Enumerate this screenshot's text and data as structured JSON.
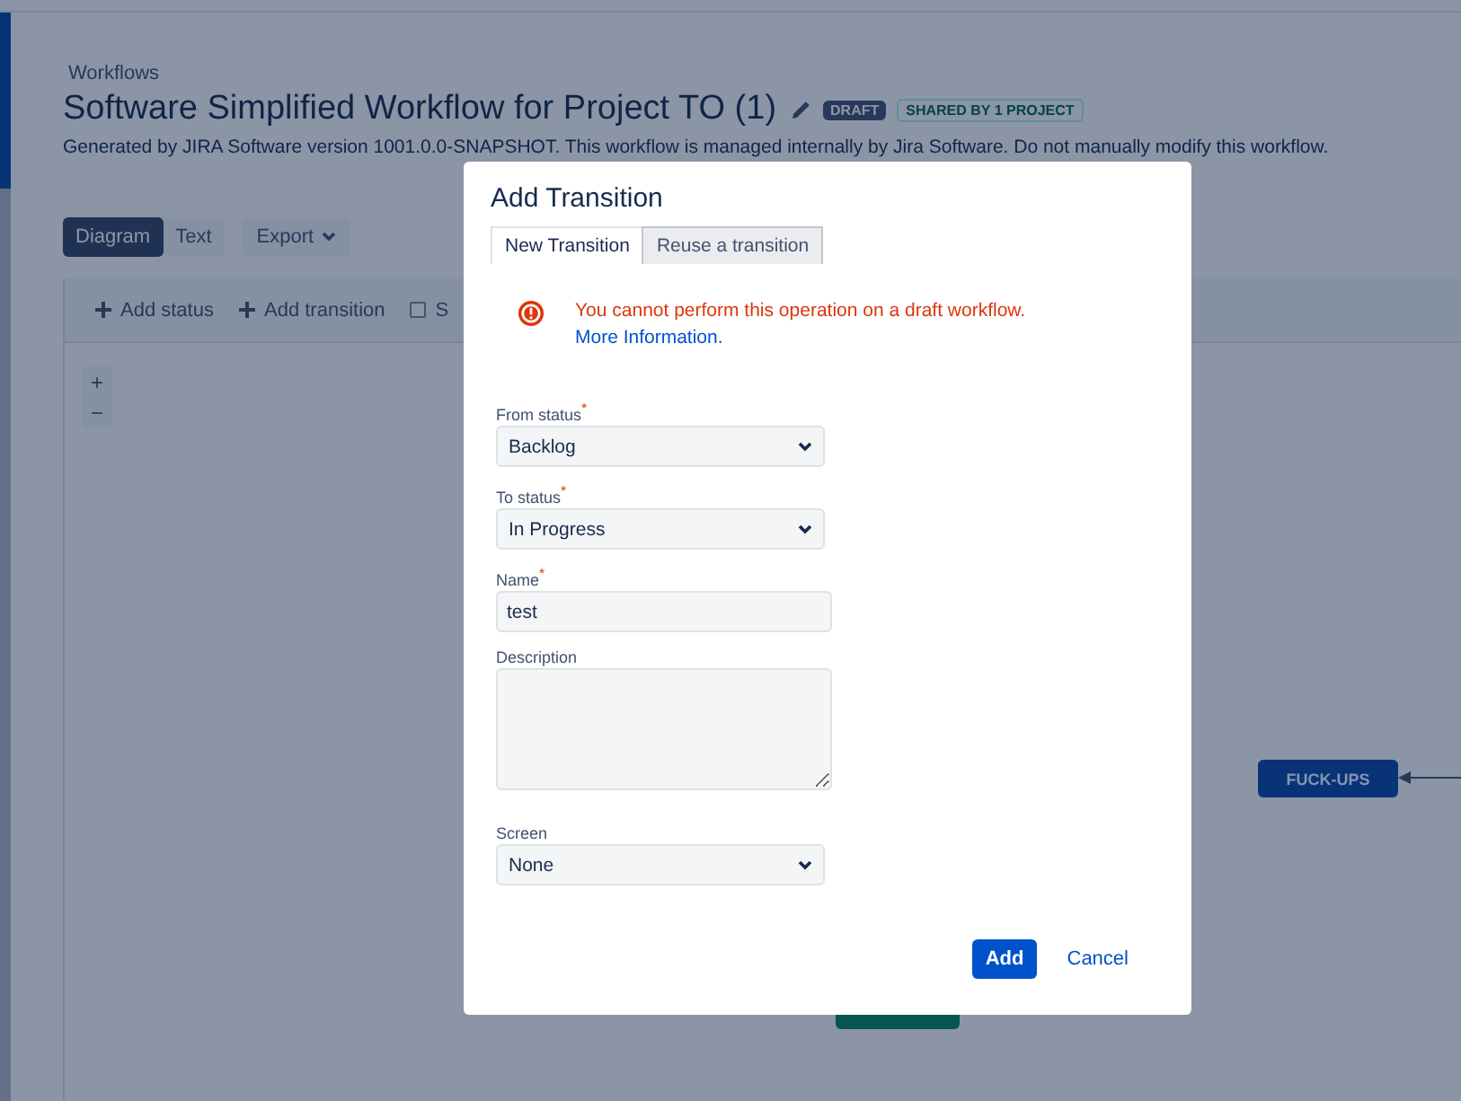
{
  "breadcrumb": "Workflows",
  "title": "Software Simplified Workflow for Project TO (1)",
  "badges": [
    {
      "label": "DRAFT",
      "kind": "draft"
    },
    {
      "label": "SHARED BY 1 PROJECT",
      "kind": "shared"
    }
  ],
  "description": "Generated by JIRA Software version 1001.0.0-SNAPSHOT. This workflow is managed internally by Jira Software. Do not manually modify this workflow.",
  "view_tabs": [
    {
      "label": "Diagram",
      "selected": true
    },
    {
      "label": "Text",
      "selected": false
    }
  ],
  "export_button": "Export",
  "toolbar": [
    {
      "label": "Add status",
      "kind": "add"
    },
    {
      "label": "Add transition",
      "kind": "add"
    },
    {
      "label": "S",
      "kind": "checkbox",
      "checked": false
    }
  ],
  "zoom": [
    "+",
    "−"
  ],
  "diagram": {
    "nodes": [
      {
        "label": "FUCK-UPS",
        "color": "#083477"
      },
      {
        "color": "#04564f"
      }
    ]
  },
  "dialog": {
    "title": "Add Transition",
    "tabs": [
      {
        "label": "New Transition",
        "selected": true
      },
      {
        "label": "Reuse a transition",
        "selected": false
      }
    ],
    "error": {
      "message": "You cannot perform this operation on a draft workflow.",
      "link": "More Information."
    },
    "fields": [
      {
        "label": "From status",
        "required_mark": "*",
        "kind": "select",
        "value": "Backlog"
      },
      {
        "label": "To status",
        "required_mark": "*",
        "kind": "select",
        "value": "In Progress"
      },
      {
        "label": "Name",
        "required_mark": "*",
        "kind": "text",
        "value": "test"
      },
      {
        "label": "Description",
        "kind": "textarea"
      },
      {
        "label": "Screen",
        "kind": "select",
        "value": "None"
      }
    ],
    "buttons": [
      {
        "label": "Add",
        "kind": "primary"
      },
      {
        "label": "Cancel",
        "kind": "link"
      }
    ]
  }
}
